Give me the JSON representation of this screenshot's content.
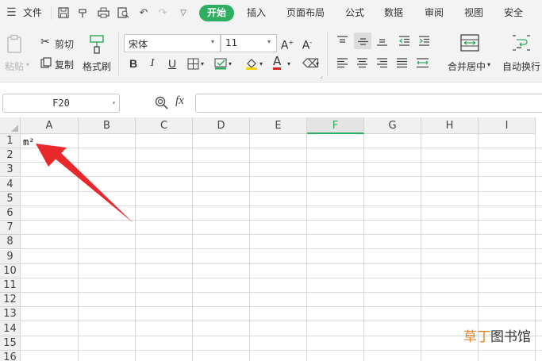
{
  "menubar": {
    "file_label": "文件",
    "tabs": [
      {
        "label": "开始",
        "active": true
      },
      {
        "label": "插入"
      },
      {
        "label": "页面布局"
      },
      {
        "label": "公式"
      },
      {
        "label": "数据"
      },
      {
        "label": "审阅"
      },
      {
        "label": "视图"
      },
      {
        "label": "安全"
      }
    ],
    "accent_color": "#2eae61"
  },
  "ribbon": {
    "paste_label": "粘贴",
    "cut_label": "剪切",
    "copy_label": "复制",
    "format_painter_label": "格式刷",
    "font_name": "宋体",
    "font_size": "11",
    "bold": "B",
    "italic": "I",
    "underline": "U",
    "font_color_letter": "A",
    "merge_center_label": "合并居中",
    "wrap_text_label": "自动换行"
  },
  "formula_bar": {
    "cell_reference": "F20",
    "fx_label": "fx",
    "formula": ""
  },
  "sheet": {
    "columns": [
      "A",
      "B",
      "C",
      "D",
      "E",
      "F",
      "G",
      "H",
      "I"
    ],
    "selected_column": "F",
    "rows": [
      "1",
      "2",
      "3",
      "4",
      "5",
      "6",
      "7",
      "8",
      "9",
      "10",
      "11",
      "12",
      "13",
      "14",
      "15",
      "16"
    ],
    "cells": [
      {
        "ref": "A1",
        "value": "m²"
      }
    ]
  },
  "watermark": {
    "part1": "草丁",
    "part2": "图书馆"
  }
}
